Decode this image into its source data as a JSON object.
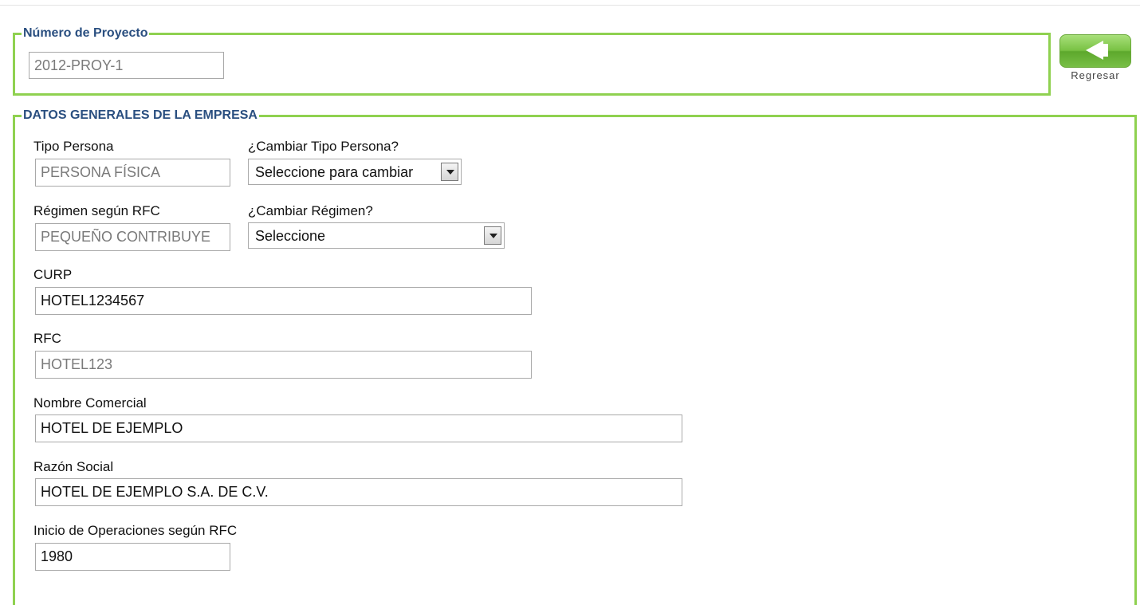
{
  "proyecto": {
    "legend": "Número de Proyecto",
    "numero": "2012-PROY-1"
  },
  "back": {
    "label": "Regresar"
  },
  "empresa": {
    "legend": "DATOS GENERALES DE LA EMPRESA",
    "tipo_persona_label": "Tipo Persona",
    "tipo_persona_value": "PERSONA FÍSICA",
    "cambiar_tipo_label": "¿Cambiar Tipo Persona?",
    "cambiar_tipo_value": "Seleccione para cambiar",
    "regimen_label": "Régimen según RFC",
    "regimen_value": "PEQUEÑO CONTRIBUYE",
    "cambiar_regimen_label": "¿Cambiar Régimen?",
    "cambiar_regimen_value": "Seleccione",
    "curp_label": "CURP",
    "curp_value": "HOTEL1234567",
    "rfc_label": "RFC",
    "rfc_value": "HOTEL123",
    "nombre_comercial_label": "Nombre Comercial",
    "nombre_comercial_value": "HOTEL DE EJEMPLO",
    "razon_social_label": "Razón Social",
    "razon_social_value": "HOTEL DE EJEMPLO S.A. DE C.V.",
    "inicio_label": "Inicio de Operaciones según RFC",
    "inicio_value": "1980"
  },
  "colors": {
    "border_green": "#8fd150",
    "legend_blue": "#2a4f80",
    "button_green": "#79c244"
  },
  "icons": {
    "back": "back-arrow-icon",
    "dropdown": "chevron-down-icon"
  }
}
